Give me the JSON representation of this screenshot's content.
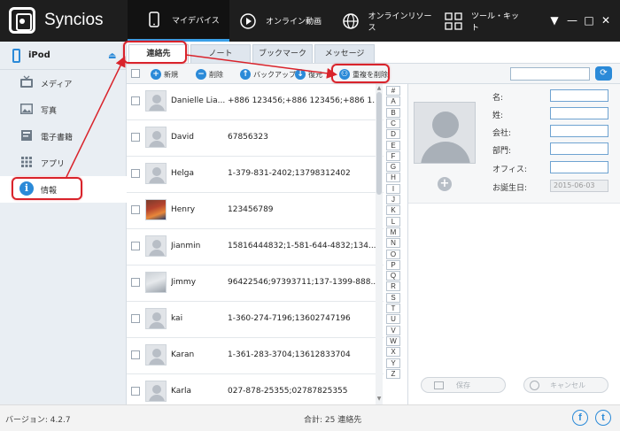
{
  "app": {
    "title": "Syncios",
    "version_text": "バージョン: 4.2.7",
    "total_text": "合計: 25 連絡先"
  },
  "nav_tabs": [
    {
      "label": "マイデバイス",
      "icon": "phone-icon"
    },
    {
      "label": "オンライン動画",
      "icon": "play-icon"
    },
    {
      "label": "オンラインリソース",
      "icon": "globe-icon"
    },
    {
      "label": "ツール・キット",
      "icon": "grid-icon"
    }
  ],
  "window_controls": [
    "▼",
    "—",
    "□",
    "✕"
  ],
  "device": {
    "name": "iPod"
  },
  "sidebar": {
    "items": [
      {
        "label": "メディア",
        "icon": "media-icon"
      },
      {
        "label": "写真",
        "icon": "photo-icon"
      },
      {
        "label": "電子書籍",
        "icon": "book-icon"
      },
      {
        "label": "アプリ",
        "icon": "app-icon"
      },
      {
        "label": "情報",
        "icon": "info-icon"
      }
    ]
  },
  "subtabs": [
    "連絡先",
    "ノート",
    "ブックマーク",
    "メッセージ"
  ],
  "toolbar": {
    "new_label": "新規",
    "delete_label": "削除",
    "backup_label": "バックアップ",
    "restore_label": "復元",
    "dedupe_label": "重複を削除",
    "search_placeholder": ""
  },
  "contacts": [
    {
      "name": "Danielle Lia...",
      "phone": "+886 123456;+886 123456;+886 1...",
      "avatar": "default"
    },
    {
      "name": "David",
      "phone": "67856323",
      "avatar": "default"
    },
    {
      "name": "Helga",
      "phone": "1-379-831-2402;13798312402",
      "avatar": "default"
    },
    {
      "name": "Henry",
      "phone": "123456789",
      "avatar": "photo-red"
    },
    {
      "name": "Jianmin",
      "phone": "15816444832;1-581-644-4832;134...",
      "avatar": "default"
    },
    {
      "name": "Jimmy",
      "phone": "96422546;97393711;137-1399-888...",
      "avatar": "photo-grey"
    },
    {
      "name": "kai",
      "phone": "1-360-274-7196;13602747196",
      "avatar": "default"
    },
    {
      "name": "Karan",
      "phone": "1-361-283-3704;13612833704",
      "avatar": "default"
    },
    {
      "name": "Karla",
      "phone": "027-878-25355;02787825355",
      "avatar": "default"
    }
  ],
  "alphabet": [
    "#",
    "A",
    "B",
    "C",
    "D",
    "E",
    "F",
    "G",
    "H",
    "I",
    "J",
    "K",
    "L",
    "M",
    "N",
    "O",
    "P",
    "Q",
    "R",
    "S",
    "T",
    "U",
    "V",
    "W",
    "X",
    "Y",
    "Z"
  ],
  "detail": {
    "fields": [
      {
        "label": "名:",
        "value": ""
      },
      {
        "label": "姓:",
        "value": ""
      },
      {
        "label": "会社:",
        "value": ""
      },
      {
        "label": "部門:",
        "value": ""
      },
      {
        "label": "オフィス:",
        "value": ""
      },
      {
        "label": "お誕生日:",
        "value": "2015-06-03"
      }
    ],
    "save_label": "保存",
    "cancel_label": "キャンセル"
  },
  "social": {
    "facebook": "f",
    "twitter": "t"
  },
  "colors": {
    "accent": "#2b8ad8",
    "annotation": "#d9232b",
    "topbar": "#1e1e1e"
  }
}
